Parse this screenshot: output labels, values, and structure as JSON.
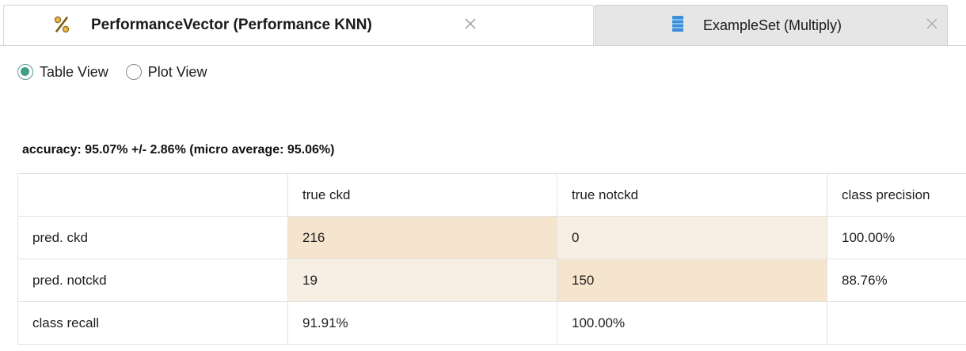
{
  "tabs": [
    {
      "label": "PerformanceVector (Performance KNN)",
      "icon": "percent-icon",
      "active": true
    },
    {
      "label": "ExampleSet (Multiply)",
      "icon": "exampleset-icon",
      "active": false
    }
  ],
  "views": {
    "table": "Table View",
    "plot": "Plot View",
    "selected": "Table View"
  },
  "summary": "accuracy: 95.07% +/- 2.86% (micro average: 95.06%)",
  "matrix": {
    "header": [
      "",
      "true ckd",
      "true notckd",
      "class precision"
    ],
    "rows": [
      {
        "label": "pred. ckd",
        "cells": [
          "216",
          "0",
          "100.00%"
        ]
      },
      {
        "label": "pred. notckd",
        "cells": [
          "19",
          "150",
          "88.76%"
        ]
      },
      {
        "label": "class recall",
        "cells": [
          "91.91%",
          "100.00%",
          ""
        ]
      }
    ]
  },
  "colors": {
    "highlight_cell": "#f6e5ce",
    "light_cell": "#f7efe4",
    "radio_accent": "#3f9e88",
    "exampleset_icon": "#3b8ed8"
  }
}
